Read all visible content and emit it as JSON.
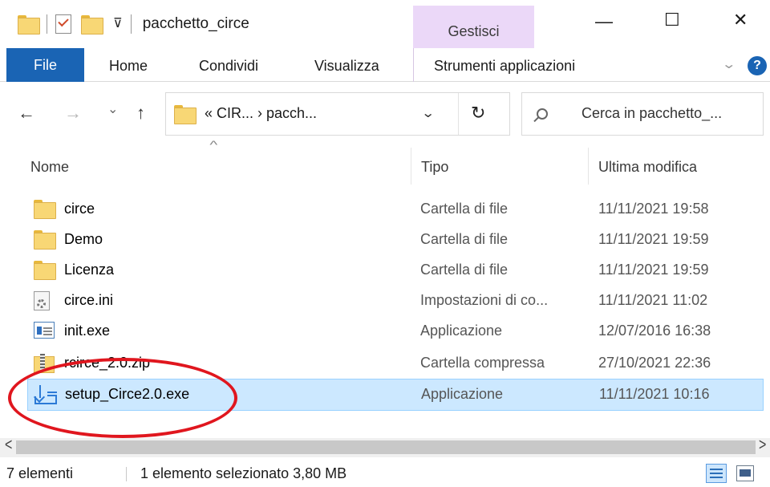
{
  "window": {
    "title": "pacchetto_circe",
    "context_tab": "Gestisci",
    "controls": {
      "minimize": "—",
      "maximize": "☐",
      "close": "✕"
    }
  },
  "ribbon": {
    "tabs": [
      "File",
      "Home",
      "Condividi",
      "Visualizza"
    ],
    "context_tab": "Strumenti applicazioni",
    "help": "?"
  },
  "nav": {
    "back": "←",
    "forward": "→",
    "recent": "⌄",
    "up": "↑",
    "address": "« CIR... › pacch...",
    "refresh": "↻",
    "search_placeholder": "Cerca in pacchetto_..."
  },
  "columns": {
    "name": "Nome",
    "type": "Tipo",
    "modified": "Ultima modifica"
  },
  "files": [
    {
      "name": "circe",
      "type": "Cartella di file",
      "modified": "11/11/2021 19:58",
      "icon": "folder-icon"
    },
    {
      "name": "Demo",
      "type": "Cartella di file",
      "modified": "11/11/2021 19:59",
      "icon": "folder-icon"
    },
    {
      "name": "Licenza",
      "type": "Cartella di file",
      "modified": "11/11/2021 19:59",
      "icon": "folder-icon"
    },
    {
      "name": "circe.ini",
      "type": "Impostazioni di co...",
      "modified": "11/11/2021 11:02",
      "icon": "settings-file-icon"
    },
    {
      "name": "init.exe",
      "type": "Applicazione",
      "modified": "12/07/2016 16:38",
      "icon": "application-icon"
    },
    {
      "name": "rcirce_2.0.zip",
      "type": "Cartella compressa",
      "modified": "27/10/2021 22:36",
      "icon": "zip-folder-icon"
    },
    {
      "name": "setup_Circe2.0.exe",
      "type": "Applicazione",
      "modified": "11/11/2021 10:16",
      "icon": "installer-icon",
      "selected": true
    }
  ],
  "status": {
    "count": "7 elementi",
    "selection": "1 elemento selezionato  3,80 MB"
  },
  "colors": {
    "file_tab": "#1a64b4",
    "context_highlight": "#ebd8f8",
    "selection_bg": "#cce8ff",
    "annotation_ellipse": "#e0161e"
  }
}
